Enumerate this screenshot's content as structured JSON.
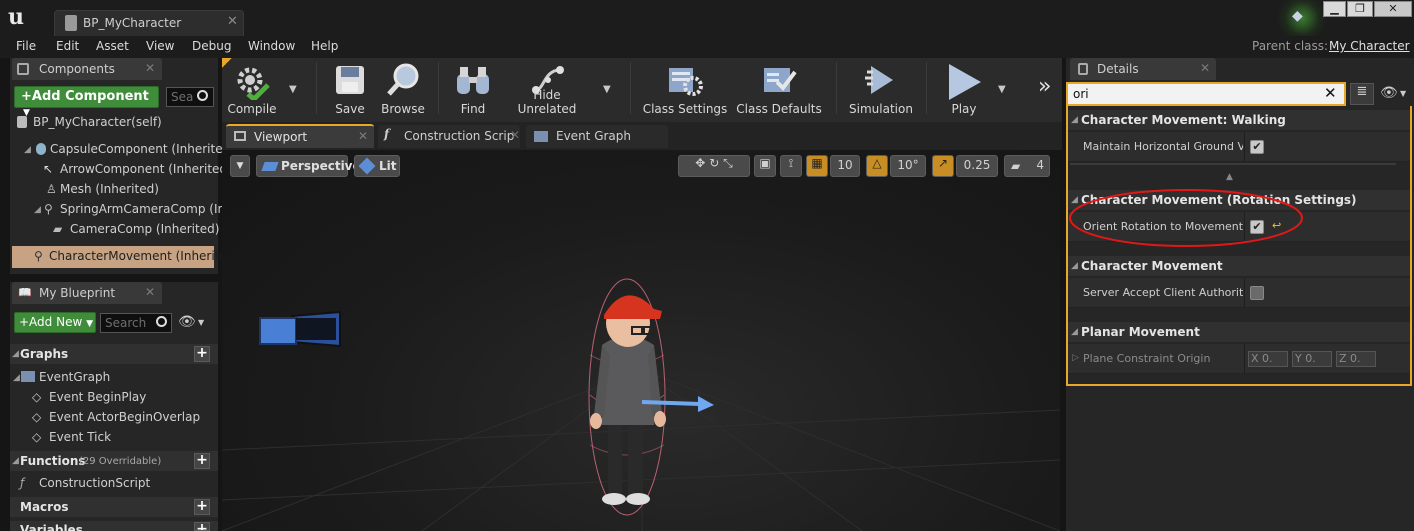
{
  "window": {
    "tab_title": "BP_MyCharacter",
    "tab_close": "✕",
    "parent_class_label": "Parent class:",
    "parent_class_value": "My Character",
    "min_glyph": "▁",
    "max_glyph": "❐",
    "close_glyph": "✕"
  },
  "menu": [
    "File",
    "Edit",
    "Asset",
    "View",
    "Debug",
    "Window",
    "Help"
  ],
  "components_panel": {
    "title": "Components",
    "add_button": "+Add Component",
    "search_placeholder": "Sea",
    "items": [
      "BP_MyCharacter(self)",
      "CapsuleComponent (Inherited)",
      "ArrowComponent (Inherited)",
      "Mesh (Inherited)",
      "SpringArmCameraComp (Inh",
      "CameraComp (Inherited)",
      "CharacterMovement (Inherited"
    ]
  },
  "blueprint_panel": {
    "title": "My Blueprint",
    "add_button": "+Add New",
    "search_placeholder": "Search",
    "graphs_header": "Graphs",
    "event_graph": "EventGraph",
    "events": [
      "Event BeginPlay",
      "Event ActorBeginOverlap",
      "Event Tick"
    ],
    "functions_header": "Functions",
    "functions_count": "(29 Overridable)",
    "construction_script": "ConstructionScript",
    "macros_header": "Macros",
    "variables_header": "Variables"
  },
  "toolbar": {
    "buttons": [
      "Compile",
      "Save",
      "Browse",
      "Find",
      "Hide Unrelated",
      "Class Settings",
      "Class Defaults",
      "Simulation",
      "Play"
    ],
    "overflow": "»"
  },
  "editor_tabs": [
    "Viewport",
    "Construction Scrip",
    "Event Graph"
  ],
  "viewport": {
    "perspective": "Perspective",
    "lit": "Lit",
    "grid_snap": "10",
    "rot_snap": "10°",
    "scale_snap": "0.25",
    "camera_speed": "4"
  },
  "details": {
    "title": "Details",
    "search_value": "ori",
    "sections": {
      "walking": "Character Movement: Walking",
      "rotation": "Character Movement (Rotation Settings)",
      "movement": "Character Movement",
      "planar": "Planar Movement"
    },
    "rows": {
      "maintain_horizontal": "Maintain Horizontal Ground Velo",
      "orient_rotation": "Orient Rotation to Movement",
      "server_accept": "Server Accept Client Authoritati",
      "plane_constraint": "Plane Constraint Origin"
    },
    "vector": {
      "x": "X  0.",
      "y": "Y  0.",
      "z": "Z  0."
    }
  },
  "colors": {
    "accent_orange": "#e8a72b",
    "selection_tan": "#c7a384",
    "annotation_red": "#e01818",
    "add_green": "#3f8d3a"
  }
}
